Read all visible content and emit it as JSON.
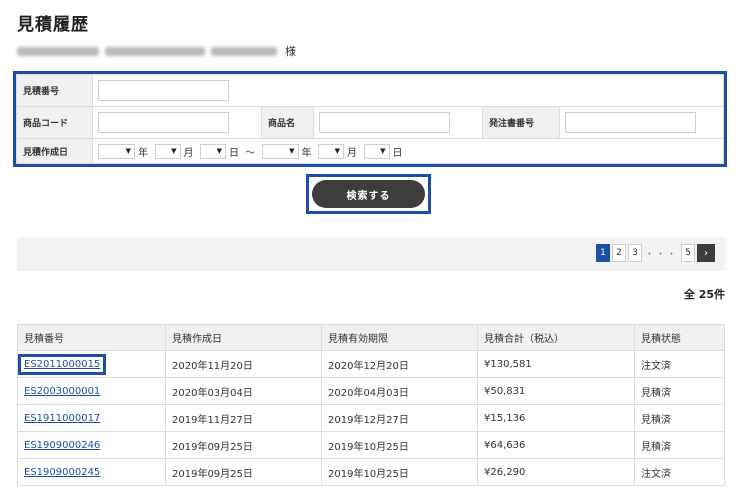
{
  "page": {
    "title": "見積履歴",
    "customer_suffix": "様"
  },
  "search": {
    "labels": {
      "quote_number": "見積番号",
      "product_code": "商品コード",
      "product_name": "商品名",
      "po_number": "発注書番号",
      "created_date": "見積作成日"
    },
    "date_units": {
      "year": "年",
      "month": "月",
      "day": "日",
      "range": "～"
    },
    "select_arrow": "▼",
    "button_label": "検索する"
  },
  "pagination": {
    "pages": [
      "1",
      "2",
      "3",
      "5"
    ],
    "ellipsis": "・・・",
    "next": "›",
    "active": "1"
  },
  "result_count": "全 25件",
  "table": {
    "headers": [
      "見積番号",
      "見積作成日",
      "見積有効期限",
      "見積合計（税込）",
      "見積状態"
    ],
    "rows": [
      [
        "ES2011000015",
        "2020年11月20日",
        "2020年12月20日",
        "¥130,581",
        "注文済"
      ],
      [
        "ES2003000001",
        "2020年03月04日",
        "2020年04月03日",
        "¥50,831",
        "見積済"
      ],
      [
        "ES1911000017",
        "2019年11月27日",
        "2019年12月27日",
        "¥15,136",
        "見積済"
      ],
      [
        "ES1909000246",
        "2019年09月25日",
        "2019年10月25日",
        "¥64,636",
        "見積済"
      ],
      [
        "ES1909000245",
        "2019年09月25日",
        "2019年10月25日",
        "¥26,290",
        "注文済"
      ]
    ]
  }
}
